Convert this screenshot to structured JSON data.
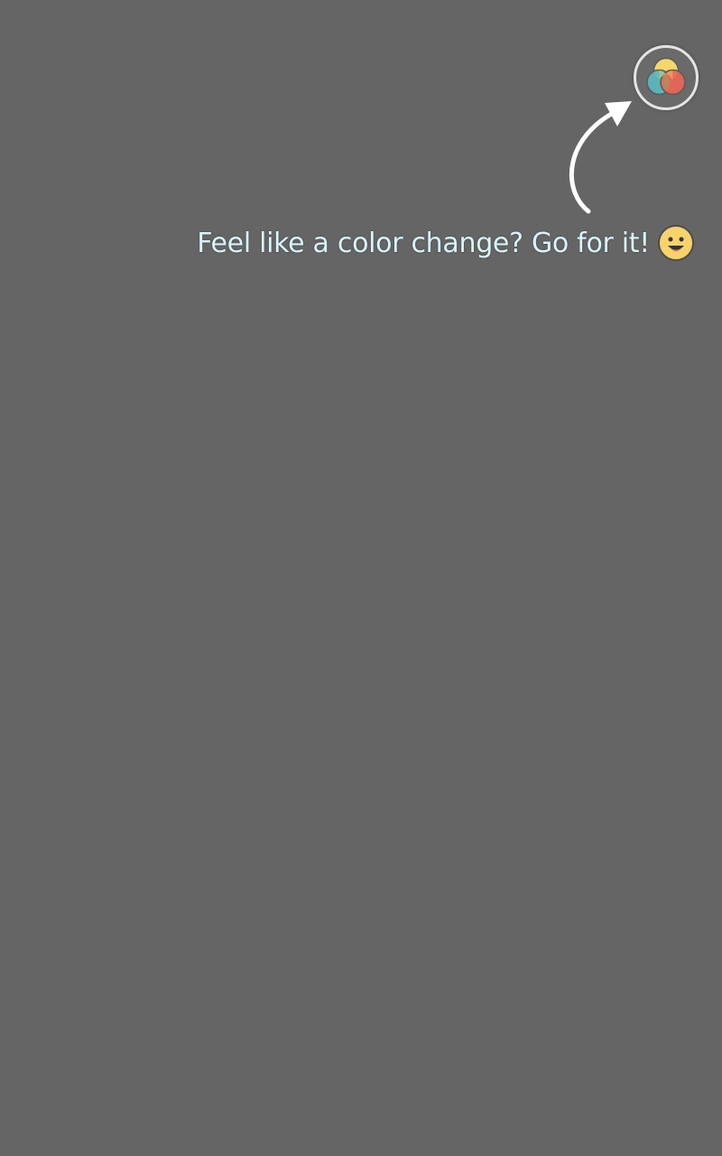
{
  "screen": {
    "background_color": "#656565"
  },
  "theme_button": {
    "icon": "color-palette-icon",
    "ring_color": "#e4e4e4",
    "colors": {
      "yellow": "#f5d66b",
      "teal": "#5ab8bf",
      "red": "#ea6655"
    }
  },
  "hint": {
    "text": "Feel like a color change? Go for it!",
    "text_color": "#d8f4fb",
    "emoji_icon": "grinning-face-icon",
    "arrow_icon": "curved-arrow-icon",
    "arrow_color": "#ffffff"
  }
}
